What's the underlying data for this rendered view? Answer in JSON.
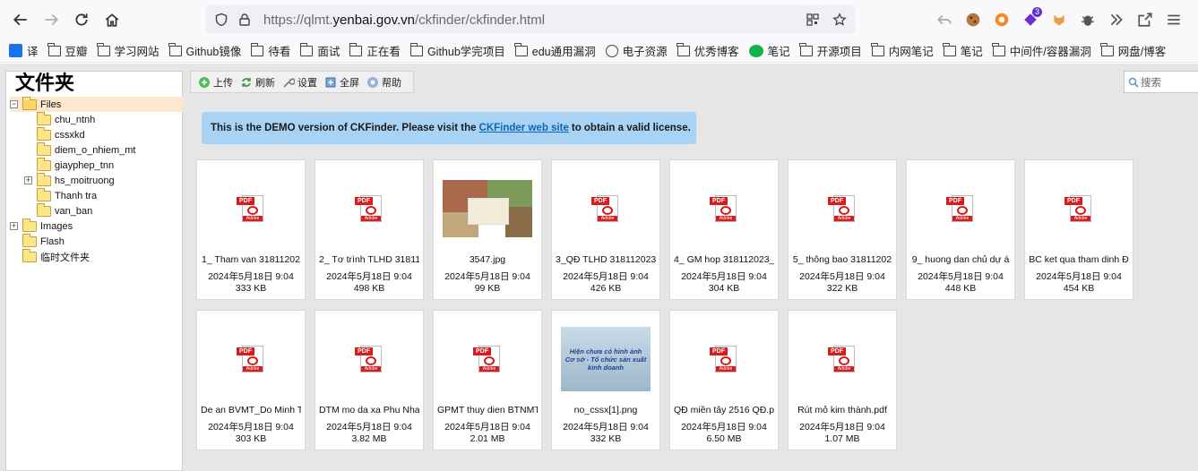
{
  "browser": {
    "url_prefix": "https://qlmt.",
    "url_domain": "yenbai.gov.vn",
    "url_path": "/ckfinder/ckfinder.html",
    "extension_badge": "3"
  },
  "bookmarks": [
    {
      "label": "译",
      "icon": "translate-icon"
    },
    {
      "label": "豆瓣",
      "icon": "folder-icon"
    },
    {
      "label": "学习网站",
      "icon": "folder-icon"
    },
    {
      "label": "Github镜像",
      "icon": "folder-icon"
    },
    {
      "label": "待看",
      "icon": "folder-icon"
    },
    {
      "label": "面试",
      "icon": "folder-icon"
    },
    {
      "label": "正在看",
      "icon": "folder-icon"
    },
    {
      "label": "Github学完项目",
      "icon": "folder-icon"
    },
    {
      "label": "edu通用漏洞",
      "icon": "folder-icon"
    },
    {
      "label": "电子资源",
      "icon": "globe-icon"
    },
    {
      "label": "优秀博客",
      "icon": "folder-icon"
    },
    {
      "label": "笔记",
      "icon": "wechat-icon"
    },
    {
      "label": "开源项目",
      "icon": "folder-icon"
    },
    {
      "label": "内网笔记",
      "icon": "folder-icon"
    },
    {
      "label": "笔记",
      "icon": "folder-icon"
    },
    {
      "label": "中间件/容器漏洞",
      "icon": "folder-icon"
    },
    {
      "label": "网盘/博客",
      "icon": "folder-icon"
    }
  ],
  "folders": {
    "title": "文件夹",
    "tree": [
      {
        "label": "Files",
        "level": 0,
        "toggle": "−",
        "selected": true
      },
      {
        "label": "chu_ntnh",
        "level": 1,
        "toggle": ""
      },
      {
        "label": "cssxkd",
        "level": 1,
        "toggle": ""
      },
      {
        "label": "diem_o_nhiem_mt",
        "level": 1,
        "toggle": ""
      },
      {
        "label": "giayphep_tnn",
        "level": 1,
        "toggle": ""
      },
      {
        "label": "hs_moitruong",
        "level": 1,
        "toggle": "+"
      },
      {
        "label": "Thanh tra",
        "level": 1,
        "toggle": ""
      },
      {
        "label": "van_ban",
        "level": 1,
        "toggle": ""
      },
      {
        "label": "Images",
        "level": 0,
        "toggle": "+"
      },
      {
        "label": "Flash",
        "level": 0,
        "toggle": ""
      },
      {
        "label": "临时文件夹",
        "level": 0,
        "toggle": ""
      }
    ]
  },
  "toolbar": {
    "upload": "上传",
    "refresh": "刷新",
    "settings": "设置",
    "fullscreen": "全屏",
    "help": "帮助"
  },
  "search": {
    "placeholder": "搜索"
  },
  "banner": {
    "before": "This is the DEMO version of CKFinder. Please visit the",
    "link": "CKFinder web site",
    "after": "to obtain a valid license."
  },
  "files": [
    {
      "name": "1_ Tham van 31811202",
      "date": "2024年5月18日 9:04",
      "size": "333 KB",
      "kind": "pdf"
    },
    {
      "name": "2_ Tơ trình TLHD 31811",
      "date": "2024年5月18日 9:04",
      "size": "498 KB",
      "kind": "pdf"
    },
    {
      "name": "3547.jpg",
      "date": "2024年5月18日 9:04",
      "size": "99 KB",
      "kind": "photo"
    },
    {
      "name": "3_QĐ TLHD 318112023",
      "date": "2024年5月18日 9:04",
      "size": "426 KB",
      "kind": "pdf"
    },
    {
      "name": "4_ GM hop 318112023_",
      "date": "2024年5月18日 9:04",
      "size": "304 KB",
      "kind": "pdf"
    },
    {
      "name": "5_ thông bao 31811202",
      "date": "2024年5月18日 9:04",
      "size": "322 KB",
      "kind": "pdf"
    },
    {
      "name": "9_ huong dan chủ dự á",
      "date": "2024年5月18日 9:04",
      "size": "448 KB",
      "kind": "pdf"
    },
    {
      "name": "BC ket qua tham dinh Đ",
      "date": "2024年5月18日 9:04",
      "size": "454 KB",
      "kind": "pdf"
    },
    {
      "name": "De an BVMT_Do Minh T",
      "date": "2024年5月18日 9:04",
      "size": "303 KB",
      "kind": "pdf"
    },
    {
      "name": "DTM mo da xa Phu Nha",
      "date": "2024年5月18日 9:04",
      "size": "3.82 MB",
      "kind": "pdf"
    },
    {
      "name": "GPMT thuy dien BTNMT",
      "date": "2024年5月18日 9:04",
      "size": "2.01 MB",
      "kind": "pdf"
    },
    {
      "name": "no_cssx[1].png",
      "date": "2024年5月18日 9:04",
      "size": "332 KB",
      "kind": "nocss"
    },
    {
      "name": "QĐ miền tây 2516 QĐ.p",
      "date": "2024年5月18日 9:04",
      "size": "6.50 MB",
      "kind": "pdf"
    },
    {
      "name": "Rút mỏ kim thành.pdf",
      "date": "2024年5月18日 9:04",
      "size": "1.07 MB",
      "kind": "pdf"
    }
  ],
  "thumbnail_text": {
    "line1": "Hiện chưa có hình ảnh",
    "line2": "Cơ sở - Tổ chức sản xuất",
    "line3": "kinh doanh"
  },
  "pdf_badge": {
    "tag": "PDF",
    "brand": "Adobe"
  },
  "colors": {
    "banner_bg": "#a9d3f5",
    "link": "#1064b4",
    "selected_folder_bg": "#fbe8cf",
    "pdf_red": "#d81c1c"
  }
}
